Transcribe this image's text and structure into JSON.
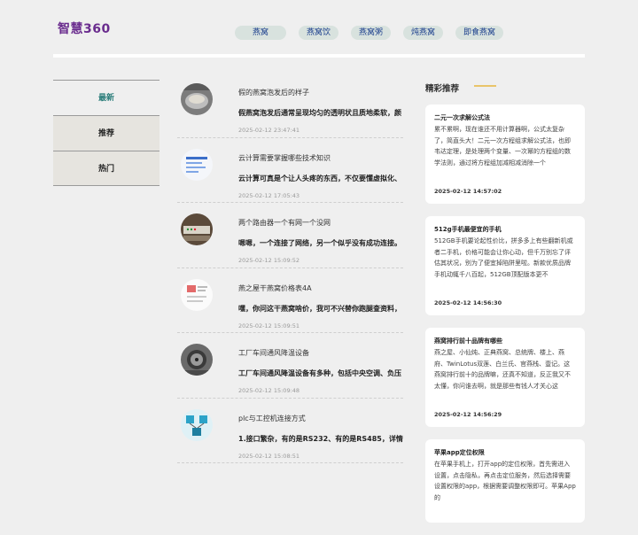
{
  "header": {
    "logo": "智慧360",
    "nav": [
      {
        "label": "燕窝"
      },
      {
        "label": "燕窝饮"
      },
      {
        "label": "燕窝粥"
      },
      {
        "label": "炖燕窝"
      },
      {
        "label": "即食燕窝"
      }
    ]
  },
  "sidebar": {
    "tabs": [
      {
        "label": "最新"
      },
      {
        "label": "推荐"
      },
      {
        "label": "热门"
      }
    ]
  },
  "articles": [
    {
      "title": "假的燕窝泡发后的样子",
      "desc": "假燕窝泡发后通常呈现均匀的透明状且质地柔软，颜",
      "time": "2025-02-12 23:47:41",
      "thumb": "grey-bowl"
    },
    {
      "title": "云计算需要掌握哪些技术知识",
      "desc": "云计算可真是个让人头疼的东西，不仅要懂虚拟化、",
      "time": "2025-02-12 17:05:43",
      "thumb": "blue-doc"
    },
    {
      "title": "两个路由器一个有网一个没网",
      "desc": "嗯嗯，一个连接了网络，另一个似乎没有成功连接。",
      "time": "2025-02-12 15:09:52",
      "thumb": "router-rack"
    },
    {
      "title": "燕之屋干燕窝价格表4A",
      "desc": "嘿，你问这干燕窝啥价，我可不兴替你跑腿查资料，",
      "time": "2025-02-12 15:09:51",
      "thumb": "price-list"
    },
    {
      "title": "工厂车间通风降温设备",
      "desc": "工厂车间通风降温设备有多种，包括中央空调、负压",
      "time": "2025-02-12 15:09:48",
      "thumb": "factory-fan"
    },
    {
      "title": "plc与工控机连接方式",
      "desc": "1.接口繁杂，有的是RS232、有的是RS485，详情得",
      "time": "2025-02-12 15:08:51",
      "thumb": "plc-diagram"
    }
  ],
  "recommend": {
    "title": "精彩推荐",
    "items": [
      {
        "title": "二元一次求解公式法",
        "body": "累不累啊，现在谁还不用计算器啊，公式太复杂了，简直头大！二元一次方程组求解公式法，也即韦达定理，是处理两个变量、一次幂的方程组的数学法则，通过将方程组加减相减消除一个",
        "time": "2025-02-12 14:57:02"
      },
      {
        "title": "512g手机最便宜的手机",
        "body": "512GB手机要论起性价比，拼多多上有些翻新机或者二手机，价格可能会让你心动，但千万别忘了评估其状况，别为了便宜掉陷阱里啦。新款优质品牌手机动辄千八百起，512GB顶配版本更不",
        "time": "2025-02-12 14:56:30"
      },
      {
        "title": "燕窝排行前十品牌有哪些",
        "body": "燕之屋、小仙炖、正典燕窝、总统牌、楼上、燕府、TwinLotus双莲、白兰氏、官燕栈、壹记。这燕窝排行前十的品牌嘛，还真不知道，反正我又不太懂，你问谁去啊，就是那些有钱人才关心这",
        "time": "2025-02-12 14:56:29"
      },
      {
        "title": "苹果app定位权限",
        "body": "在苹果手机上，打开app的定位权限，首先需进入设置，点击隐私，再点击定位服务，然后选择需要设置权限的app，根据需要调整权限即可。苹果App的",
        "time": ""
      }
    ]
  }
}
